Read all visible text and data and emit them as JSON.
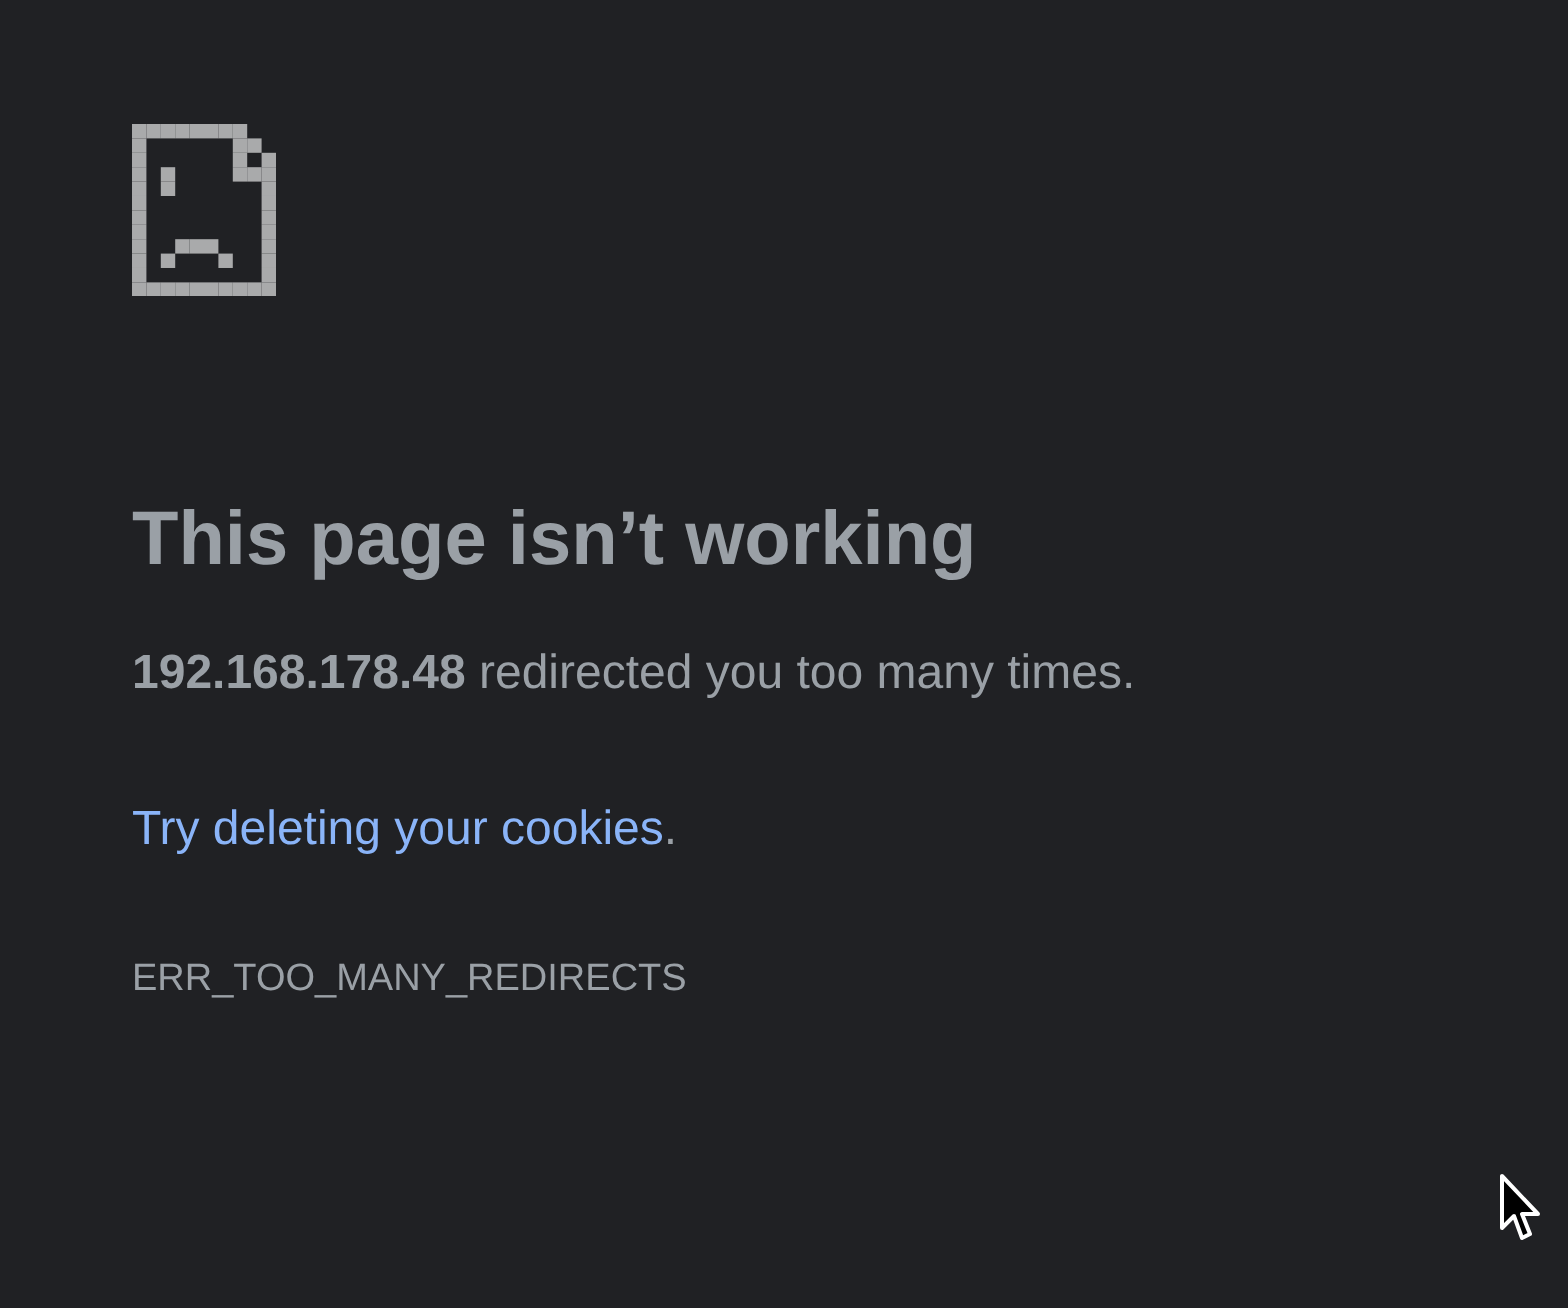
{
  "heading": "This page isn’t working",
  "message": "**192.168.178.48** redirected you too many times.",
  "suggestion": {
    "link": "Try deleting your cookies",
    "tail": "."
  },
  "error_code": "ERR_TOO_MANY_REDIRECTS"
}
